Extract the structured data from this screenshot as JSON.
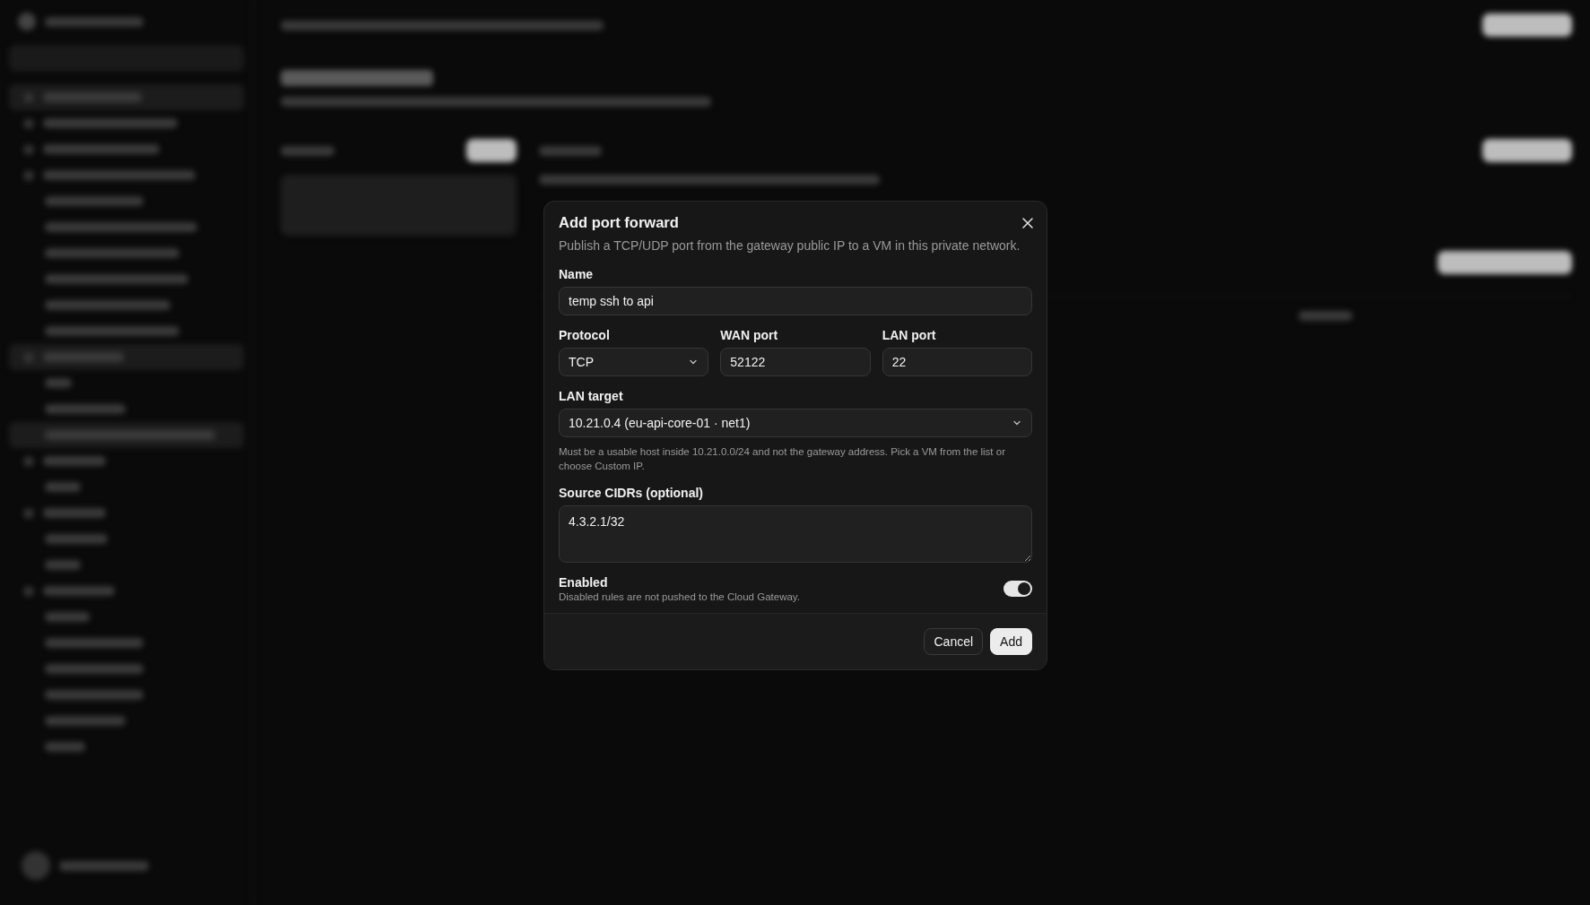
{
  "dialog": {
    "title": "Add port forward",
    "description": "Publish a TCP/UDP port from the gateway public IP to a VM in this private network.",
    "rows": [
      [
        {
          "kind": "text",
          "label": "Name",
          "value": "temp ssh to api"
        }
      ],
      [
        {
          "kind": "select",
          "label": "Protocol",
          "value": "TCP"
        },
        {
          "kind": "text",
          "label": "WAN port",
          "value": "52122"
        },
        {
          "kind": "text",
          "label": "LAN port",
          "value": "22"
        }
      ],
      [
        {
          "kind": "select",
          "label": "LAN target",
          "value": "10.21.0.4 (eu-api-core-01 · net1)",
          "hint": "Must be a usable host inside 10.21.0.0/24 and not the gateway address. Pick a VM from the list or choose Custom IP."
        }
      ],
      [
        {
          "kind": "textarea",
          "label": "Source CIDRs (optional)",
          "value": "4.3.2.1/32"
        }
      ]
    ],
    "toggle": {
      "label": "Enabled",
      "description": "Disabled rules are not pushed to the Cloud Gateway.",
      "on": true
    },
    "buttons": [
      {
        "label": "Cancel",
        "kind": "secondary"
      },
      {
        "label": "Add",
        "kind": "primary"
      }
    ]
  }
}
